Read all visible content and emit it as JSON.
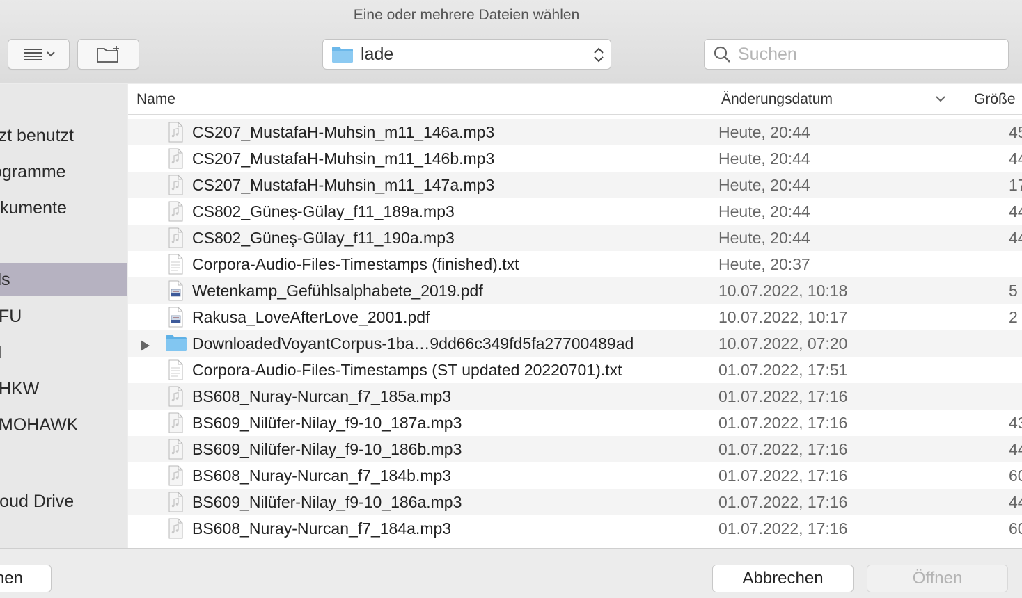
{
  "window": {
    "title": "Eine oder mehrere Dateien wählen"
  },
  "toolbar": {
    "view_icon": "list-view-icon",
    "new_folder_icon": "new-folder-icon",
    "location": "lade",
    "search_placeholder": "Suchen"
  },
  "sidebar": {
    "items": [
      {
        "label": "Zuletzt benutzt",
        "selected": false
      },
      {
        "label": "Programme",
        "selected": false
      },
      {
        "label": "Dokumente",
        "selected": false
      },
      {
        "label": "Downloads",
        "selected": true
      },
      {
        "label": "FU",
        "selected": false
      },
      {
        "label": "I",
        "selected": false
      },
      {
        "label": "HKW",
        "selected": false
      },
      {
        "label": "MOHAWK",
        "selected": false
      },
      {
        "label": "iCloud Drive",
        "selected": false
      }
    ]
  },
  "columns": {
    "name": "Name",
    "date": "Änderungsdatum",
    "size": "Größe"
  },
  "files": [
    {
      "name": "CS207_MustafaH-Muhsin_m11_146a.mp3",
      "date": "Heute, 20:44",
      "size": "45",
      "type": "audio"
    },
    {
      "name": "CS207_MustafaH-Muhsin_m11_146b.mp3",
      "date": "Heute, 20:44",
      "size": "44",
      "type": "audio"
    },
    {
      "name": "CS207_MustafaH-Muhsin_m11_147a.mp3",
      "date": "Heute, 20:44",
      "size": "17",
      "type": "audio"
    },
    {
      "name": "CS802_Güneş-Gülay_f11_189a.mp3",
      "date": "Heute, 20:44",
      "size": "44",
      "type": "audio"
    },
    {
      "name": "CS802_Güneş-Gülay_f11_190a.mp3",
      "date": "Heute, 20:44",
      "size": "44",
      "type": "audio"
    },
    {
      "name": "Corpora-Audio-Files-Timestamps (finished).txt",
      "date": "Heute, 20:37",
      "size": "",
      "type": "text"
    },
    {
      "name": "Wetenkamp_Gefühlsalphabete_2019.pdf",
      "date": "10.07.2022, 10:18",
      "size": "5",
      "type": "pdf"
    },
    {
      "name": "Rakusa_LoveAfterLove_2001.pdf",
      "date": "10.07.2022, 10:17",
      "size": "2",
      "type": "pdf"
    },
    {
      "name": "DownloadedVoyantCorpus-1ba…9dd66c349fd5fa27700489ad",
      "date": "10.07.2022, 07:20",
      "size": "",
      "type": "folder"
    },
    {
      "name": "Corpora-Audio-Files-Timestamps (ST updated 20220701).txt",
      "date": "01.07.2022, 17:51",
      "size": "",
      "type": "text"
    },
    {
      "name": "BS608_Nuray-Nurcan_f7_185a.mp3",
      "date": "01.07.2022, 17:16",
      "size": "",
      "type": "audio"
    },
    {
      "name": "BS609_Nilüfer-Nilay_f9-10_187a.mp3",
      "date": "01.07.2022, 17:16",
      "size": "43",
      "type": "audio"
    },
    {
      "name": "BS609_Nilüfer-Nilay_f9-10_186b.mp3",
      "date": "01.07.2022, 17:16",
      "size": "44",
      "type": "audio"
    },
    {
      "name": "BS608_Nuray-Nurcan_f7_184b.mp3",
      "date": "01.07.2022, 17:16",
      "size": "60",
      "type": "audio"
    },
    {
      "name": "BS609_Nilüfer-Nilay_f9-10_186a.mp3",
      "date": "01.07.2022, 17:16",
      "size": "44",
      "type": "audio"
    },
    {
      "name": "BS608_Nuray-Nurcan_f7_184a.mp3",
      "date": "01.07.2022, 17:16",
      "size": "60",
      "type": "audio"
    }
  ],
  "buttons": {
    "options": "Optionen",
    "cancel": "Abbrechen",
    "open": "Öffnen"
  },
  "colors": {
    "folder": "#6cb8ea",
    "selection": "#b6b2c1"
  }
}
